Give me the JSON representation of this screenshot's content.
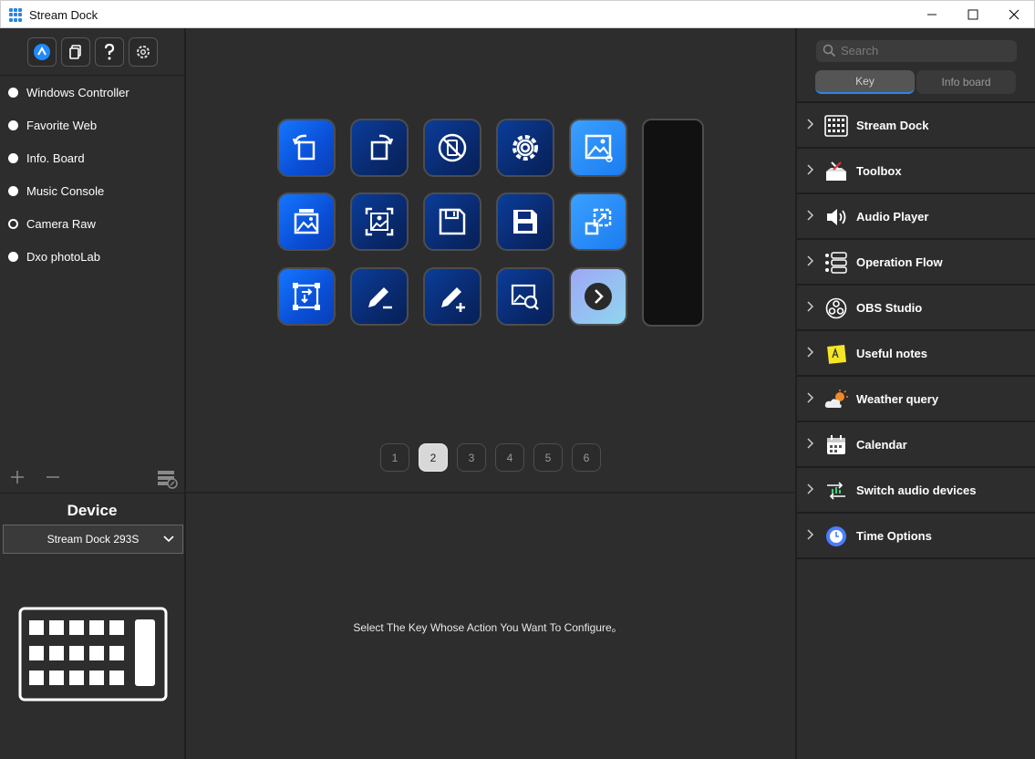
{
  "window": {
    "title": "Stream Dock"
  },
  "left": {
    "profiles": [
      {
        "label": "Windows Controller",
        "selected": false
      },
      {
        "label": "Favorite Web",
        "selected": false
      },
      {
        "label": "Info. Board",
        "selected": false
      },
      {
        "label": "Music Console",
        "selected": false
      },
      {
        "label": "Camera Raw",
        "selected": true
      },
      {
        "label": "Dxo photoLab",
        "selected": false
      }
    ],
    "device_title": "Device",
    "device_selected": "Stream Dock 293S"
  },
  "center": {
    "pages": [
      "1",
      "2",
      "3",
      "4",
      "5",
      "6"
    ],
    "active_page": "2",
    "hint": "Select The Key Whose Action You Want To Configure。"
  },
  "right": {
    "search_placeholder": "Search",
    "tabs": [
      {
        "label": "Key",
        "active": true
      },
      {
        "label": "Info board",
        "active": false
      }
    ],
    "plugins": [
      {
        "label": "Stream Dock",
        "icon": "grid-keypad-icon"
      },
      {
        "label": "Toolbox",
        "icon": "toolbox-icon"
      },
      {
        "label": "Audio Player",
        "icon": "speaker-icon"
      },
      {
        "label": "Operation Flow",
        "icon": "flow-icon"
      },
      {
        "label": "OBS Studio",
        "icon": "obs-icon"
      },
      {
        "label": "Useful notes",
        "icon": "note-icon"
      },
      {
        "label": "Weather query",
        "icon": "weather-icon"
      },
      {
        "label": "Calendar",
        "icon": "calendar-icon"
      },
      {
        "label": "Switch audio devices",
        "icon": "audio-switch-icon"
      },
      {
        "label": "Time Options",
        "icon": "clock-icon"
      }
    ]
  }
}
